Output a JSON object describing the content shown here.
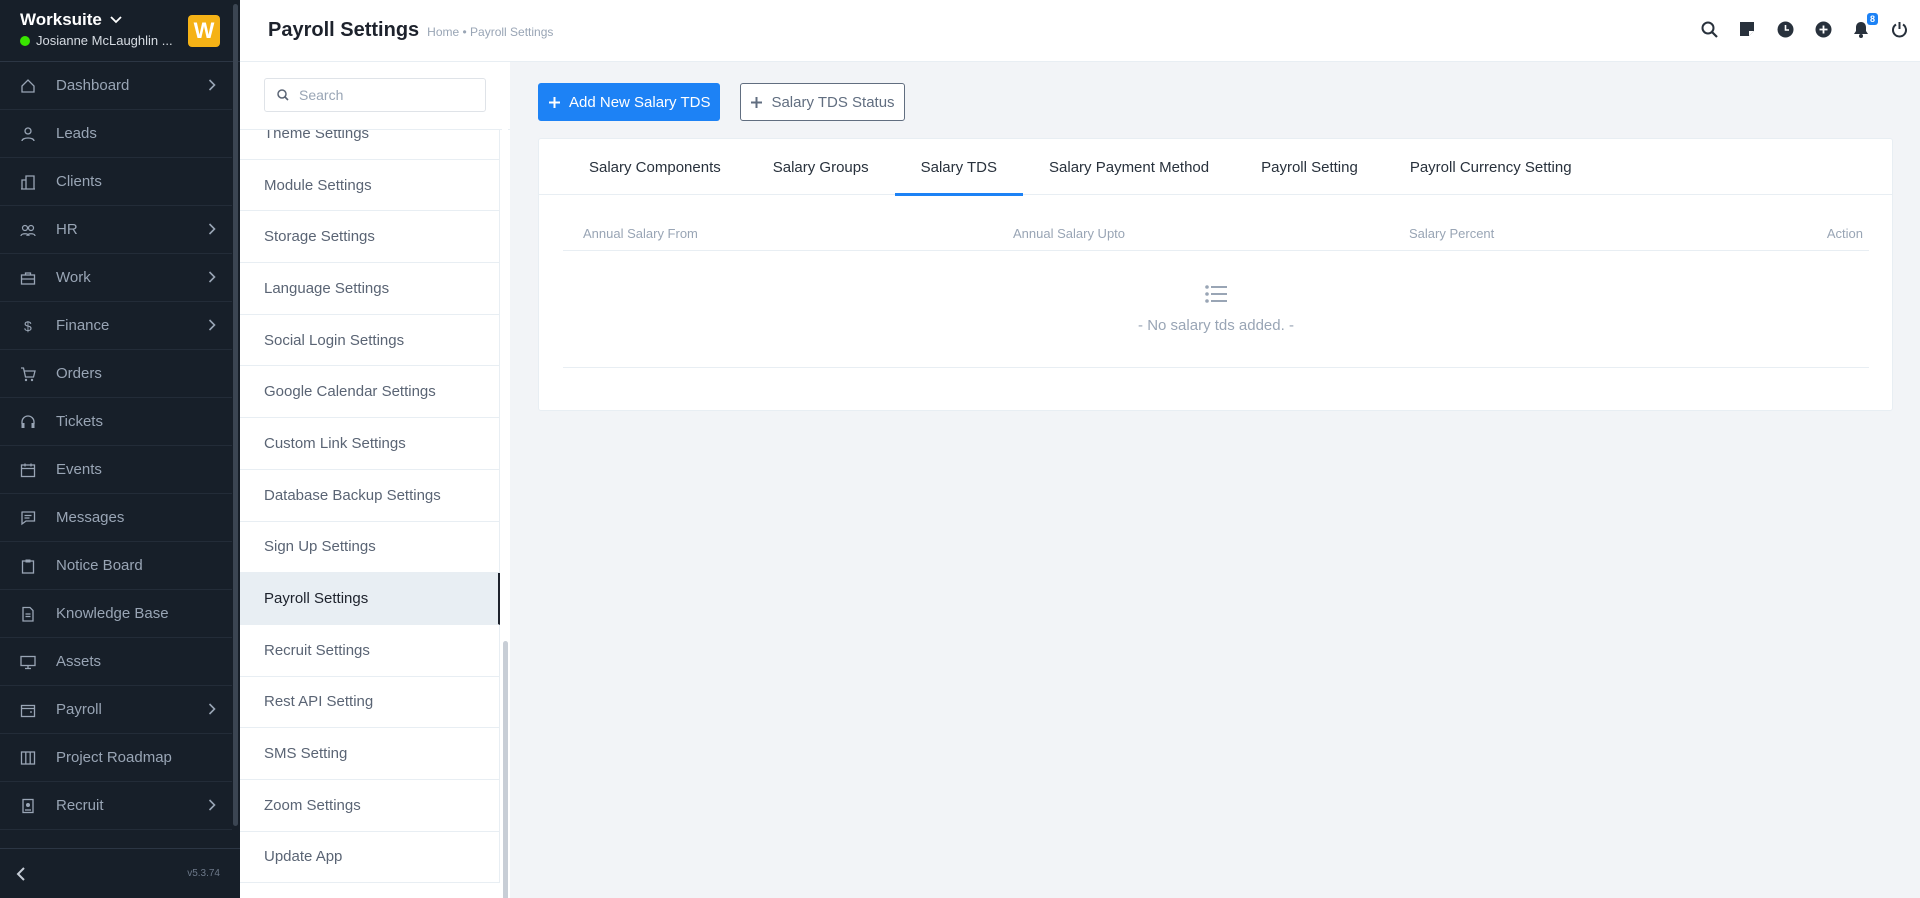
{
  "sidebar": {
    "brand": "Worksuite",
    "user": "Josianne McLaughlin ...",
    "logo_letter": "W",
    "version": "v5.3.74",
    "items": [
      {
        "label": "Dashboard",
        "icon": "house-icon",
        "has_chevron": true
      },
      {
        "label": "Leads",
        "icon": "person-icon",
        "has_chevron": false
      },
      {
        "label": "Clients",
        "icon": "building-icon",
        "has_chevron": false
      },
      {
        "label": "HR",
        "icon": "people-icon",
        "has_chevron": true
      },
      {
        "label": "Work",
        "icon": "briefcase-icon",
        "has_chevron": true
      },
      {
        "label": "Finance",
        "icon": "dollar-icon",
        "has_chevron": true
      },
      {
        "label": "Orders",
        "icon": "cart-icon",
        "has_chevron": false
      },
      {
        "label": "Tickets",
        "icon": "headset-icon",
        "has_chevron": false
      },
      {
        "label": "Events",
        "icon": "calendar-icon",
        "has_chevron": false
      },
      {
        "label": "Messages",
        "icon": "chat-icon",
        "has_chevron": false
      },
      {
        "label": "Notice Board",
        "icon": "clipboard-icon",
        "has_chevron": false
      },
      {
        "label": "Knowledge Base",
        "icon": "document-icon",
        "has_chevron": false
      },
      {
        "label": "Assets",
        "icon": "monitor-icon",
        "has_chevron": false
      },
      {
        "label": "Payroll",
        "icon": "wallet-icon",
        "has_chevron": true
      },
      {
        "label": "Project Roadmap",
        "icon": "columns-icon",
        "has_chevron": false
      },
      {
        "label": "Recruit",
        "icon": "id-badge-icon",
        "has_chevron": true
      }
    ]
  },
  "header": {
    "title": "Payroll Settings",
    "breadcrumb": "Home • Payroll Settings",
    "notification_count": "8"
  },
  "settings_menu": {
    "search_placeholder": "Search",
    "items": [
      "Theme Settings",
      "Module Settings",
      "Storage Settings",
      "Language Settings",
      "Social Login Settings",
      "Google Calendar Settings",
      "Custom Link Settings",
      "Database Backup Settings",
      "Sign Up Settings",
      "Payroll Settings",
      "Recruit Settings",
      "Rest API Setting",
      "SMS Setting",
      "Zoom Settings",
      "Update App"
    ],
    "active_item": "Payroll Settings"
  },
  "toolbar": {
    "add_button": "Add New Salary TDS",
    "status_button": "Salary TDS Status"
  },
  "tabs": {
    "items": [
      "Salary Components",
      "Salary Groups",
      "Salary TDS",
      "Salary Payment Method",
      "Payroll Setting",
      "Payroll Currency Setting"
    ],
    "active": "Salary TDS"
  },
  "table": {
    "columns": [
      "Annual Salary From",
      "Annual Salary Upto",
      "Salary Percent",
      "Action"
    ],
    "empty_message": "- No salary tds added. -"
  },
  "colors": {
    "sidebar_bg": "#171f29",
    "accent": "#1d82f5",
    "logo": "#f5b216",
    "online": "#39e500"
  }
}
